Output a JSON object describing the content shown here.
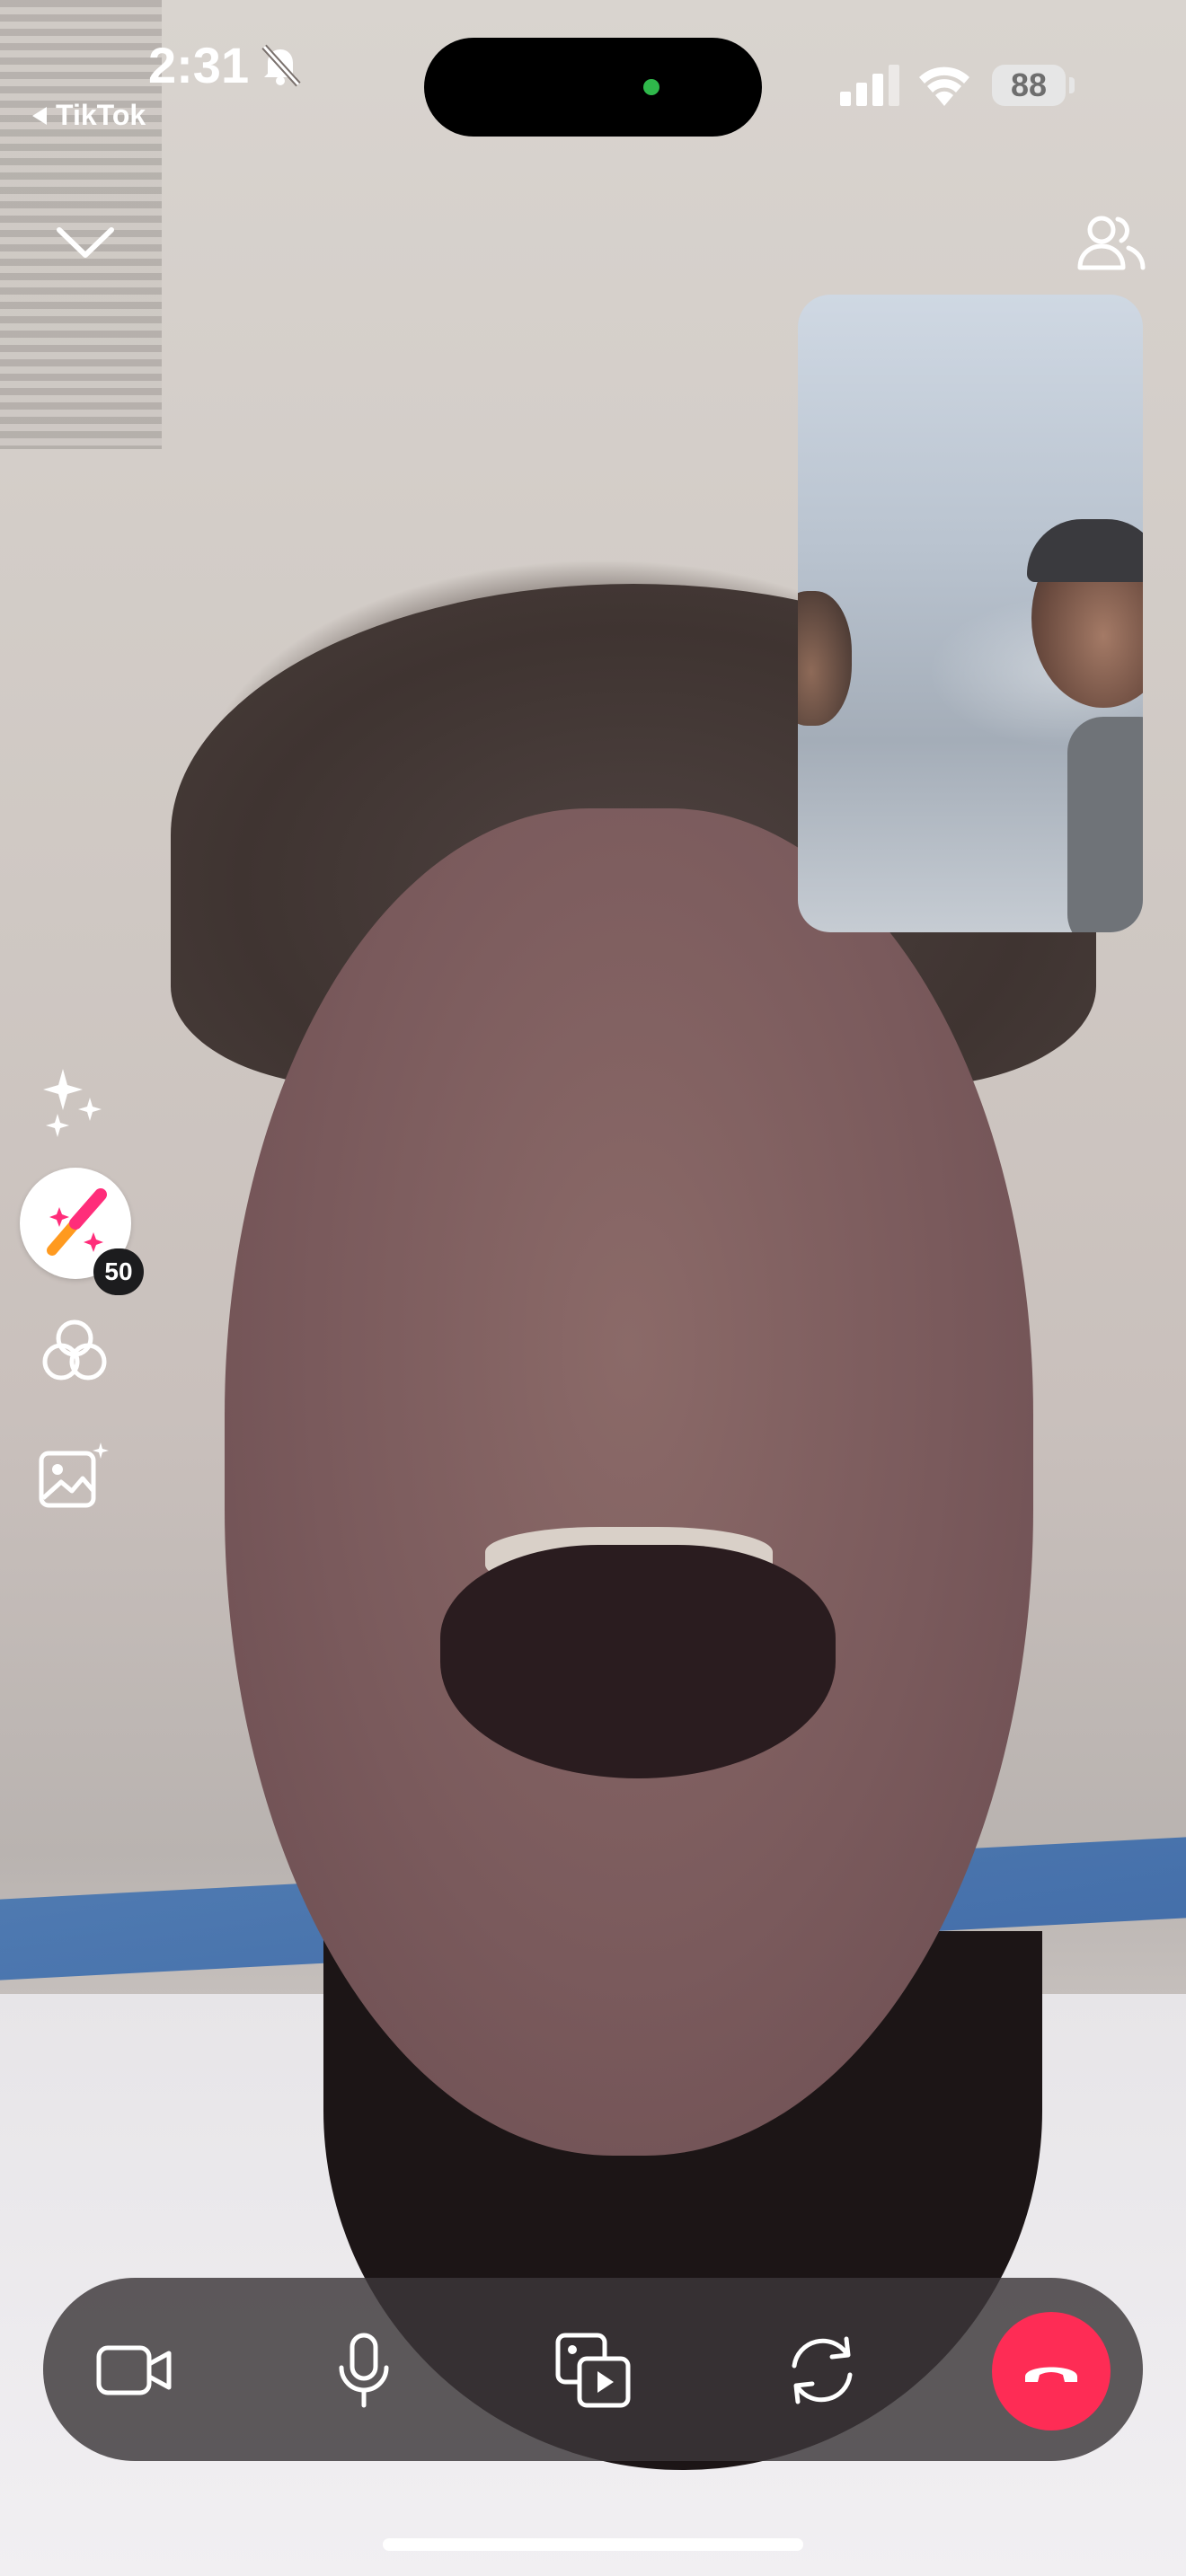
{
  "status_bar": {
    "time": "2:31",
    "back_app": "TikTok",
    "battery": "88",
    "icons": [
      "bell-slash-icon",
      "cellular-signal-icon",
      "wifi-icon",
      "battery-icon"
    ]
  },
  "top_controls": {
    "collapse_icon": "chevron-down-icon",
    "participants_icon": "people-icon"
  },
  "side_tools": {
    "items": [
      {
        "name": "sparkles-icon"
      },
      {
        "name": "magic-wand-icon",
        "badge": "50"
      },
      {
        "name": "filters-icon"
      },
      {
        "name": "background-image-icon"
      }
    ]
  },
  "call_controls": {
    "items": [
      "video-camera-icon",
      "microphone-icon",
      "share-media-icon",
      "flip-camera-icon",
      "end-call-icon"
    ]
  },
  "colors": {
    "end_call": "#fe2c55",
    "bar": "#3c3739",
    "camera_indicator": "#2fb84b"
  }
}
